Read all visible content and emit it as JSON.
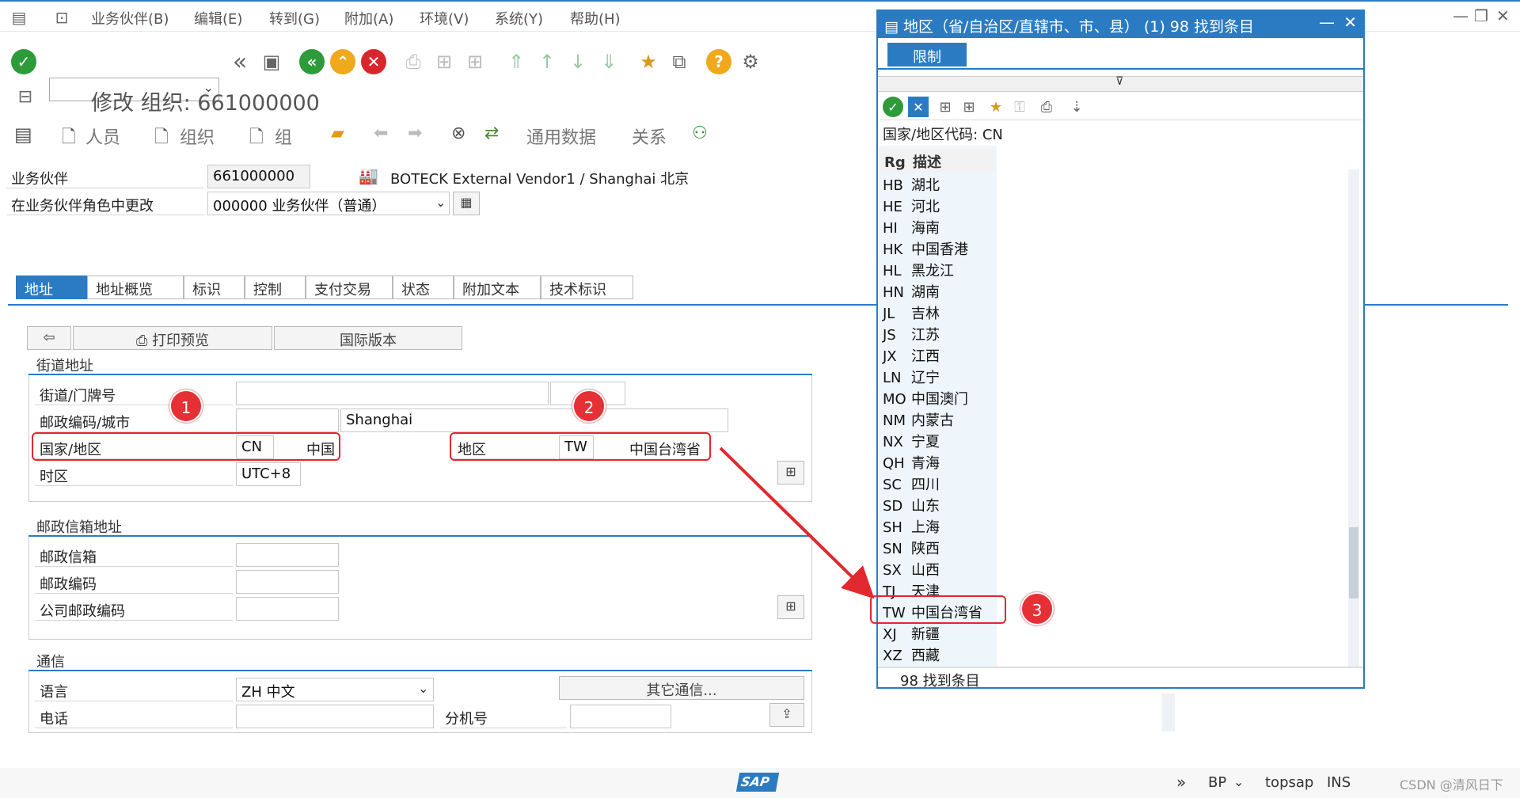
{
  "menu": {
    "items": [
      "业务伙伴(B)",
      "编辑(E)",
      "转到(G)",
      "附加(A)",
      "环境(V)",
      "系统(Y)",
      "帮助(H)"
    ]
  },
  "page_title": "修改 组织: 661000000",
  "app_toolbar": {
    "person": "人员",
    "organization": "组织",
    "group": "组",
    "general_data": "通用数据",
    "relations": "关系"
  },
  "header": {
    "bp_label": "业务伙伴",
    "bp_value": "661000000",
    "bp_desc": "BOTECK External Vendor1 / Shanghai 北京",
    "role_label": "在业务伙伴角色中更改",
    "role_value": "000000 业务伙伴（普通）"
  },
  "tabs": [
    "地址",
    "地址概览",
    "标识",
    "控制",
    "支付交易",
    "状态",
    "附加文本",
    "技术标识"
  ],
  "address": {
    "print_preview": "打印预览",
    "intl_version": "国际版本",
    "street_section": "街道地址",
    "street_label": "街道/门牌号",
    "postal_city_label": "邮政编码/城市",
    "city_value": "Shanghai",
    "country_label": "国家/地区",
    "country_code": "CN",
    "country_name": "中国",
    "region_label": "地区",
    "region_code": "TW",
    "region_name": "中国台湾省",
    "timezone_label": "时区",
    "timezone_value": "UTC+8",
    "pobox_section": "邮政信箱地址",
    "pobox_label": "邮政信箱",
    "pobox_postal_label": "邮政编码",
    "company_postal_label": "公司邮政编码",
    "comm_section": "通信",
    "language_label": "语言",
    "language_value": "ZH 中文",
    "other_comm": "其它通信...",
    "phone_label": "电话",
    "extension_label": "分机号"
  },
  "annotations": {
    "badge1": "1",
    "badge2": "2",
    "badge3": "3"
  },
  "popup": {
    "title": "地区（省/自治区/直辖市、市、县） (1)   98 找到条目",
    "restrict_tab": "限制",
    "country_filter": "国家/地区代码: CN",
    "col_rg": "Rg",
    "col_desc": "描述",
    "rows": [
      {
        "code": "HB",
        "name": "湖北"
      },
      {
        "code": "HE",
        "name": "河北"
      },
      {
        "code": "HI",
        "name": "海南"
      },
      {
        "code": "HK",
        "name": "中国香港"
      },
      {
        "code": "HL",
        "name": "黑龙江"
      },
      {
        "code": "HN",
        "name": "湖南"
      },
      {
        "code": "JL",
        "name": "吉林"
      },
      {
        "code": "JS",
        "name": "江苏"
      },
      {
        "code": "JX",
        "name": "江西"
      },
      {
        "code": "LN",
        "name": "辽宁"
      },
      {
        "code": "MO",
        "name": "中国澳门"
      },
      {
        "code": "NM",
        "name": "内蒙古"
      },
      {
        "code": "NX",
        "name": "宁夏"
      },
      {
        "code": "QH",
        "name": "青海"
      },
      {
        "code": "SC",
        "name": "四川"
      },
      {
        "code": "SD",
        "name": "山东"
      },
      {
        "code": "SH",
        "name": "上海"
      },
      {
        "code": "SN",
        "name": "陕西"
      },
      {
        "code": "SX",
        "name": "山西"
      },
      {
        "code": "TJ",
        "name": "天津"
      },
      {
        "code": "TW",
        "name": "中国台湾省"
      },
      {
        "code": "XJ",
        "name": "新疆"
      },
      {
        "code": "XZ",
        "name": "西藏"
      }
    ],
    "footer": "98 找到条目"
  },
  "statusbar": {
    "logo": "SAP",
    "tcode": "BP",
    "server": "topsap",
    "mode": "INS",
    "watermark": "CSDN @清风日下"
  },
  "colors": {
    "accent": "#2b7bc3",
    "highlight": "#e0282e"
  }
}
